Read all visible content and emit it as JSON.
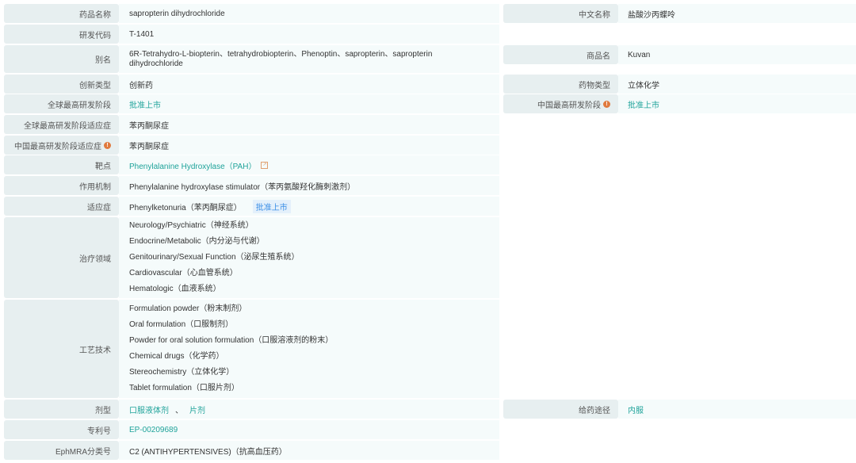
{
  "rows": {
    "name": {
      "label": "药品名称",
      "value": "sapropterin dihydrochloride",
      "rlabel": "中文名称",
      "rvalue": "盐酸沙丙蝶呤"
    },
    "code": {
      "label": "研发代码",
      "value": "T-1401"
    },
    "alias": {
      "label": "别名",
      "value": "6R-Tetrahydro-L-biopterin、tetrahydrobiopterin、Phenoptin、sapropterin、sapropterin dihydrochloride",
      "rlabel": "商品名",
      "rvalue": "Kuvan"
    },
    "innov": {
      "label": "创新类型",
      "value": "创新药",
      "rlabel": "药物类型",
      "rvalue": "立体化学"
    },
    "global_phase": {
      "label": "全球最高研发阶段",
      "value": "批准上市",
      "rlabel": "中国最高研发阶段",
      "rvalue": "批准上市"
    },
    "global_ind": {
      "label": "全球最高研发阶段适应症",
      "value": "苯丙酮尿症"
    },
    "china_ind": {
      "label": "中国最高研发阶段适应症",
      "value": "苯丙酮尿症"
    },
    "target": {
      "label": "靶点",
      "value": "Phenylalanine Hydroxylase（PAH）"
    },
    "mech": {
      "label": "作用机制",
      "value": "Phenylalanine hydroxylase stimulator（苯丙氨酸羟化酶刺激剂）"
    },
    "indication": {
      "label": "适应症",
      "value": "Phenylketonuria（苯丙酮尿症）",
      "badge": "批准上市"
    },
    "areas": {
      "label": "治疗领域",
      "items": [
        "Neurology/Psychiatric（神经系统）",
        "Endocrine/Metabolic（内分泌与代谢）",
        "Genitourinary/Sexual Function（泌尿生殖系统）",
        "Cardiovascular（心血管系统）",
        "Hematologic（血液系统）"
      ]
    },
    "tech": {
      "label": "工艺技术",
      "items": [
        "Formulation powder（粉末制剂）",
        "Oral formulation（口服制剂）",
        "Powder for oral solution formulation（口服溶液剂的粉末）",
        "Chemical drugs（化学药）",
        "Stereochemistry（立体化学）",
        "Tablet formulation（口服片剂）"
      ]
    },
    "dosage": {
      "label": "剂型",
      "values": [
        "口服液体剂",
        "片剂"
      ],
      "sep": "、",
      "rlabel": "给药途径",
      "rvalue": "内服"
    },
    "patent": {
      "label": "专利号",
      "value": "EP-00209689"
    },
    "ephmra": {
      "label": "EphMRA分类号",
      "value": "C2 (ANTIHYPERTENSIVES)（抗高血压药）"
    }
  },
  "colors": {
    "link": "#1fa39a",
    "info": "#e07a3e"
  }
}
